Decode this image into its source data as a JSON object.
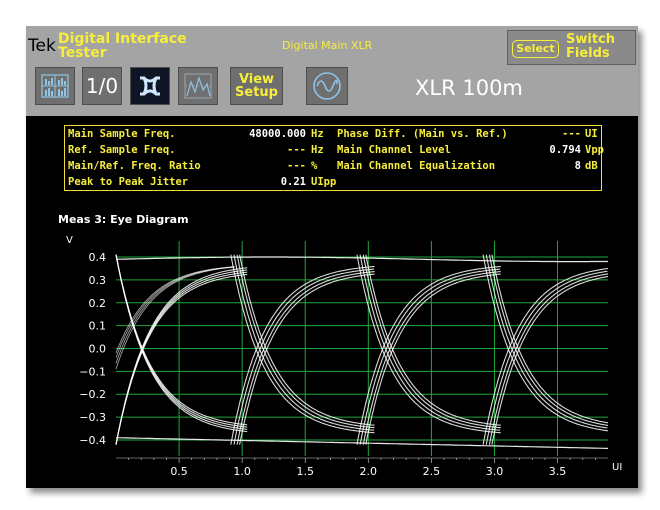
{
  "header": {
    "brand": "Tek",
    "app_line1": "Digital Interface",
    "app_line2": "Tester",
    "mode": "Digital Main XLR",
    "select_label": "Select",
    "switch_line1": "Switch",
    "switch_line2": "Fields"
  },
  "toolbar": {
    "buttons": [
      {
        "name": "bar-graph-icon"
      },
      {
        "name": "one-zero-button",
        "label": "1/0"
      },
      {
        "name": "eye-diagram-icon"
      },
      {
        "name": "histogram-icon"
      },
      {
        "name": "view-setup-button",
        "line1": "View",
        "line2": "Setup"
      },
      {
        "name": "waveform-icon"
      }
    ],
    "title": "XLR 100m"
  },
  "status": {
    "left": [
      {
        "label": "Main Sample Freq.",
        "value": "48000.000",
        "unit": "Hz"
      },
      {
        "label": "Ref. Sample Freq.",
        "value": "---",
        "unit": "Hz"
      },
      {
        "label": "Main/Ref. Freq. Ratio",
        "value": "---",
        "unit": "%"
      },
      {
        "label": "Peak to Peak Jitter",
        "value": "0.21",
        "unit": "UIpp"
      }
    ],
    "right": [
      {
        "label": "Phase Diff. (Main vs. Ref.)",
        "value": "---",
        "unit": "UI"
      },
      {
        "label": "Main Channel Level",
        "value": "0.794",
        "unit": "Vpp"
      },
      {
        "label": "Main Channel Equalization",
        "value": "8",
        "unit": "dB"
      }
    ]
  },
  "measurement_title": "Meas 3: Eye Diagram",
  "chart_data": {
    "type": "line",
    "ylabel": "V",
    "xlabel": "UI",
    "xlim": [
      0,
      3.9
    ],
    "ylim": [
      -0.47,
      0.47
    ],
    "x_ticks": [
      0.5,
      1.0,
      1.5,
      2.0,
      2.5,
      3.0,
      3.5
    ],
    "x_tick_labels": [
      "0.5",
      "1.0",
      "1.5",
      "2.0",
      "2.5",
      "3.0",
      "3.5"
    ],
    "y_ticks": [
      0.4,
      0.3,
      0.2,
      0.1,
      0.0,
      -0.1,
      -0.2,
      -0.3,
      -0.4
    ],
    "y_tick_labels": [
      "0.4",
      "0.3",
      "0.2",
      "0.1",
      "0.0",
      "−0.1",
      "−0.2",
      "−0.3",
      "−0.4"
    ],
    "grid": true,
    "trace_color": "#ffffff",
    "grid_color": "#1fa83a",
    "series": [
      {
        "values_x": [
          0.0,
          1.0,
          2.0,
          3.0,
          3.9
        ],
        "values_y": [
          -0.4,
          0.4,
          -0.4,
          0.4,
          -0.4
        ]
      },
      {
        "values_x": [
          0.0,
          1.0,
          2.0,
          3.0,
          3.9
        ],
        "values_y": [
          0.4,
          -0.4,
          0.4,
          -0.4,
          0.4
        ]
      },
      {
        "values_x": [
          0.0,
          1.0,
          2.0,
          3.0,
          3.9
        ],
        "values_y": [
          0.38,
          0.4,
          0.38,
          0.4,
          0.39
        ]
      },
      {
        "values_x": [
          0.0,
          1.0,
          2.0,
          3.0,
          3.9
        ],
        "values_y": [
          -0.38,
          -0.41,
          -0.43,
          -0.44,
          -0.44
        ]
      }
    ]
  },
  "colors": {
    "header_bg": "#a4a4a4",
    "label_yellow": "#f7ee3c",
    "screen_bg": "#000000"
  }
}
